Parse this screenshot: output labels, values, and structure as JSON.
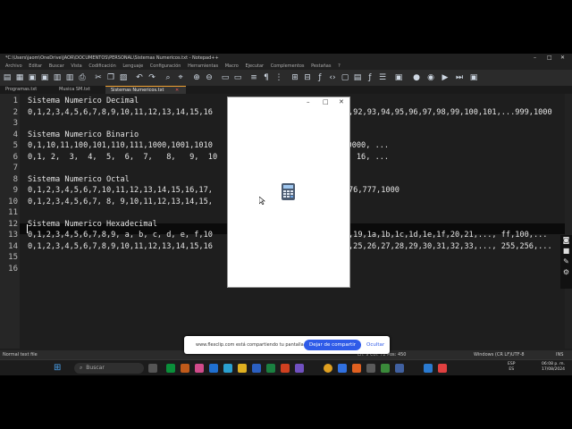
{
  "window": {
    "title": "*C:\\Users\\jaom\\OneDrive\\JAOR\\DOCUMENTOS\\PERSONAL\\Sistemas Numericos.txt - Notepad++"
  },
  "menu": [
    "Archivo",
    "Editar",
    "Buscar",
    "Vista",
    "Codificación",
    "Lenguaje",
    "Configuración",
    "Herramientas",
    "Macro",
    "Ejecutar",
    "Complementos",
    "Pestañas",
    "?"
  ],
  "tabs": [
    {
      "label": "Programas.txt"
    },
    {
      "label": "Musica SM.txt"
    },
    {
      "label": "Sistemas Numericos.txt"
    }
  ],
  "editor": {
    "line_numbers": [
      "1",
      "2",
      "3",
      "4",
      "5",
      "6",
      "7",
      "8",
      "9",
      "10",
      "11",
      "12",
      "13",
      "14",
      "15",
      "16"
    ],
    "lines": [
      "Sistema Numerico Decimal",
      "0,1,2,3,4,5,6,7,8,9,10,11,12,13,14,15,16",
      "",
      "Sistema Numerico Binario",
      "0,1,10,11,100,101,110,111,1000,1001,1010",
      "0,1, 2,  3,  4,  5,  6,  7,   8,   9,  10",
      "",
      "Sistema Numerico Octal",
      "0,1,2,3,4,5,6,7,10,11,12,13,14,15,16,17,",
      "0,1,2,3,4,5,6,7, 8, 9,10,11,12,13,14,15,",
      "",
      "Sistema Numerico Hexadecimal",
      "0,1,2,3,4,5,6,7,8,9, a, b, c, d, e, f,10",
      "0,1,2,3,4,5,6,7,8,9,10,11,12,13,14,15,16",
      "",
      ""
    ],
    "right_fragments": [
      {
        "line": 2,
        "text": ",92,93,94,95,96,97,98,99,100,101,...999,1000"
      },
      {
        "line": 5,
        "text": "1,10000, ..."
      },
      {
        "line": 6,
        "text": "5,   16, ..."
      },
      {
        "line": 9,
        "text": "76,777,1000"
      },
      {
        "line": 13,
        "text": ",19,1a,1b,1c,1d,1e,1f,20,21,..., ff,100,..."
      },
      {
        "line": 14,
        "text": ",25,26,27,28,29,30,31,32,33,..., 255,256,..."
      }
    ]
  },
  "status": {
    "type": "Normal text file",
    "position": "Ln: 9   Col: 72   Pos: 450",
    "eol": "Windows (CR LF)",
    "encoding": "UTF-8",
    "mode": "INS"
  },
  "calculator": {
    "icon": "calculator-icon"
  },
  "share_banner": {
    "message": "www.flexclip.com está compartiendo tu pantalla.",
    "stop_label": "Dejar de compartir",
    "hide_label": "Ocultar"
  },
  "taskbar": {
    "search_placeholder": "Buscar",
    "lang_top": "ESP",
    "lang_bottom": "ES",
    "time": "06:08 p. m.",
    "date": "17/08/2024"
  },
  "colors": {
    "editor_bg": "#1e1e1e",
    "accent_blue": "#2f5be8",
    "tab_active": "#f0a030"
  }
}
